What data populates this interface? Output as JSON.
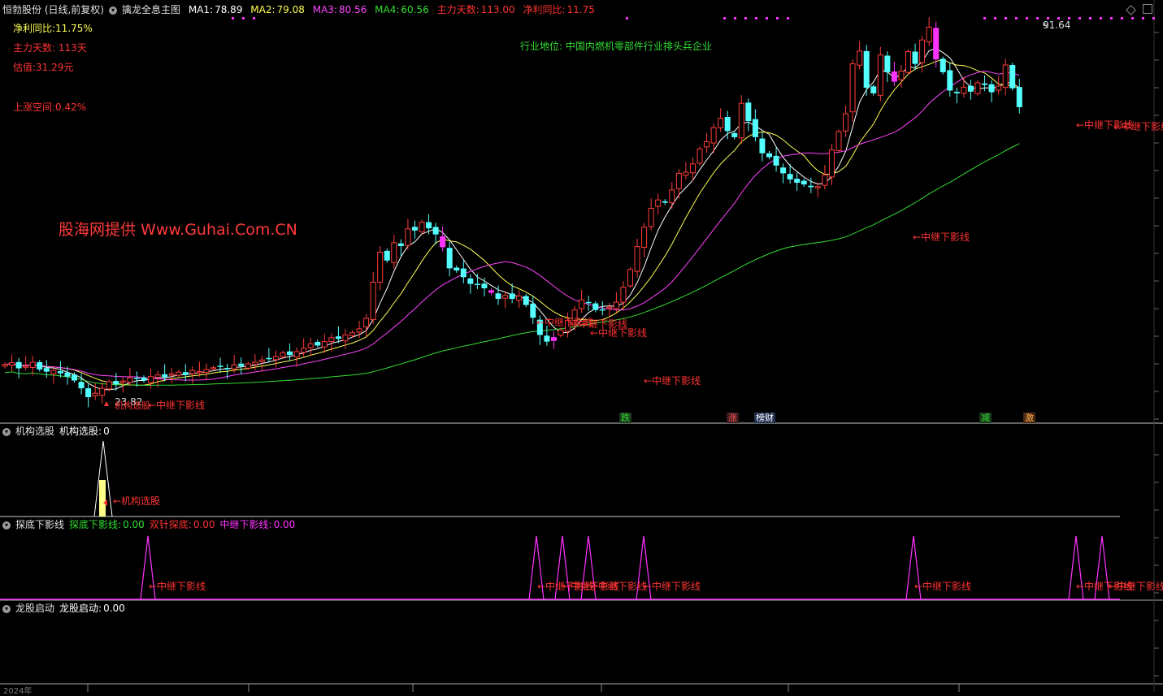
{
  "header": {
    "stock": "恒勃股份 (日线,前复权)",
    "indicator": "擒龙全息主图",
    "ma1_label": "MA1:",
    "ma1": "78.89",
    "ma2_label": "MA2:",
    "ma2": "79.08",
    "ma3_label": "MA3:",
    "ma3": "80.56",
    "ma4_label": "MA4:",
    "ma4": "60.56",
    "main_days_label": "主力天数:",
    "main_days": "113.00",
    "net_profit_label": "净利同比:",
    "net_profit": "11.75"
  },
  "info": {
    "net_profit": "净利同比:11.75%",
    "main_days": "主力天数: 113天",
    "valuation": "估值:31.29元",
    "upside": "上涨空间:0.42%"
  },
  "watermark": "股海网提供 Www.Guhai.Com.CN",
  "industry": "行业地位: 中国内燃机零部件行业排头兵企业",
  "annotations": {
    "high": "91.64",
    "low": "23.82",
    "mid_shadow": "←中继下影线",
    "inst_pick": "←机构选股"
  },
  "badges": [
    {
      "text": "跌",
      "color": "#33dd33",
      "bg": "#1a3a1a"
    },
    {
      "text": "涨",
      "color": "#ff5555",
      "bg": "#3a1a1a"
    },
    {
      "text": "榜财",
      "color": "#ffffff",
      "bg": "#203050"
    },
    {
      "text": "减",
      "color": "#33dd33",
      "bg": "#1a3a1a"
    },
    {
      "text": "激",
      "color": "#ffaa55",
      "bg": "#4a2a10"
    }
  ],
  "panel2": {
    "title": "机构选股",
    "label": "机构选股:",
    "value": "0"
  },
  "panel3": {
    "title": "探底下影线",
    "l1": "探底下影线:",
    "v1": "0.00",
    "l2": "双针探底:",
    "v2": "0.00",
    "l3": "中继下影线:",
    "v3": "0.00"
  },
  "panel4": {
    "title": "龙股启动",
    "label": "龙股启动:",
    "value": "0.00"
  },
  "xaxis": {
    "year": "2024年"
  },
  "colors": {
    "up": "#ff3b3b",
    "down": "#54ffff",
    "ma1": "#ffffff",
    "ma2": "#ffff55",
    "ma3": "#ff44ff",
    "ma4": "#33dd33",
    "special": "#ff33ff"
  },
  "chart_data": {
    "type": "candlestick",
    "price_range": [
      23.82,
      91.64
    ],
    "closes": [
      30.5,
      30.8,
      29.8,
      30.2,
      30.9,
      29.6,
      29.2,
      29.4,
      28.9,
      28.3,
      27.6,
      26.2,
      24.6,
      25.3,
      26.2,
      27.4,
      26.9,
      27.5,
      28.1,
      27.9,
      27.6,
      28.3,
      28.6,
      28.2,
      28.8,
      29.1,
      28.6,
      29.4,
      29.2,
      29.6,
      29.9,
      30.1,
      29.7,
      30.4,
      30.2,
      30.6,
      30.9,
      31.3,
      31.6,
      31.9,
      32.6,
      32.2,
      32.8,
      33.4,
      34.2,
      33.9,
      34.6,
      35.3,
      35.1,
      35.8,
      36.2,
      36.9,
      38.8,
      45.3,
      50.7,
      49.2,
      52.4,
      51.8,
      54.9,
      54.6,
      56.1,
      55.0,
      53.9,
      51.6,
      47.8,
      47.4,
      46.2,
      45.0,
      44.8,
      44.2,
      43.4,
      42.3,
      42.9,
      42.3,
      42.8,
      41.2,
      38.9,
      35.8,
      34.6,
      35.4,
      36.7,
      38.4,
      40.3,
      42.1,
      41.6,
      40.3,
      40.4,
      40.8,
      41.7,
      44.4,
      47.6,
      51.7,
      55.2,
      58.6,
      60.1,
      59.6,
      61.9,
      64.9,
      65.1,
      66.6,
      69.3,
      70.6,
      73.1,
      74.8,
      72.5,
      71.4,
      77.5,
      74.3,
      71.4,
      68.5,
      67.8,
      66.3,
      64.9,
      63.8,
      63.2,
      62.9,
      62.4,
      62.5,
      64.6,
      69.1,
      72.4,
      75.6,
      84.6,
      86.9,
      80.3,
      79.3,
      86.2,
      83.1,
      81.4,
      83.3,
      86.8,
      84.6,
      88.9,
      91.2,
      85.4,
      83.1,
      79.8,
      79.3,
      80.4,
      79.6,
      81.2,
      80.8,
      79.5,
      80.6,
      84.4,
      80.2,
      76.8
    ]
  }
}
